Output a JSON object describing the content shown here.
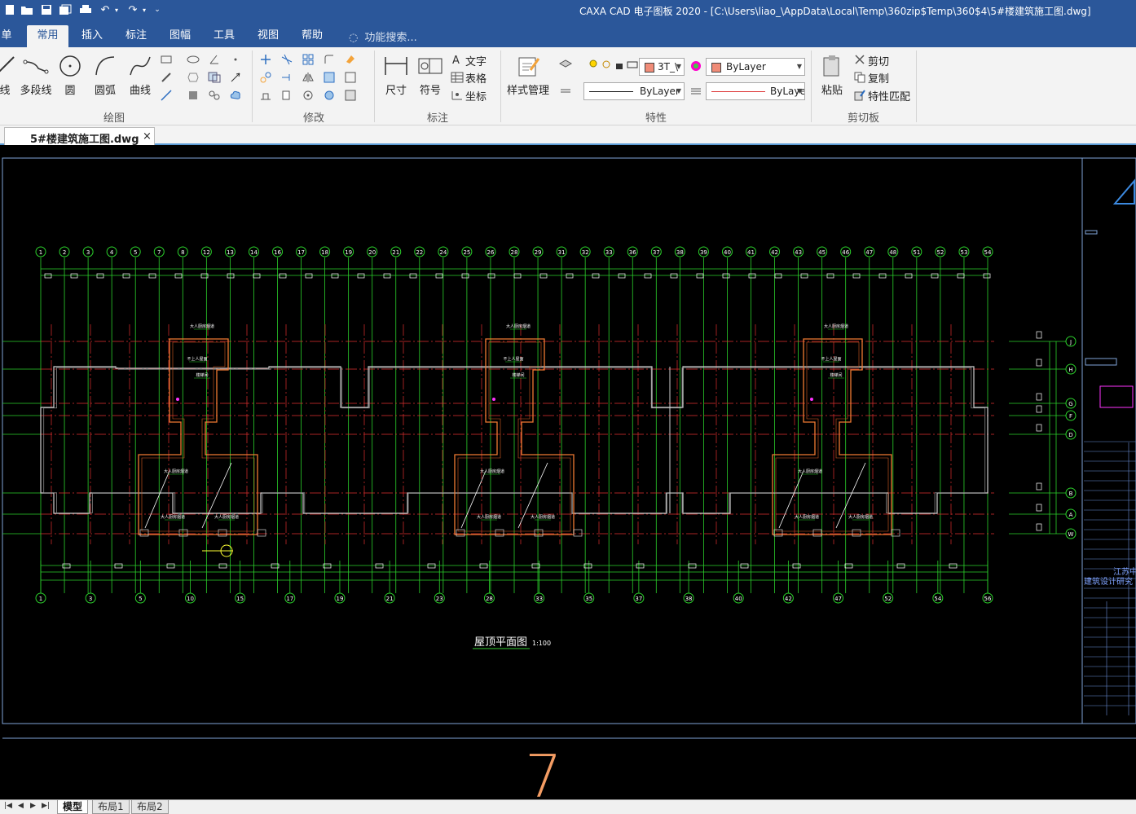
{
  "app": {
    "title": "CAXA CAD 电子图板 2020 - [C:\\Users\\liao_\\AppData\\Local\\Temp\\360zip$Temp\\360$4\\5#楼建筑施工图.dwg]"
  },
  "menu": {
    "tabs": [
      "单",
      "常用",
      "插入",
      "标注",
      "图幅",
      "工具",
      "视图",
      "帮助"
    ],
    "active": "常用",
    "search_placeholder": "功能搜索..."
  },
  "ribbon": {
    "groups": {
      "draw": "绘图",
      "modify": "修改",
      "annotate": "标注",
      "properties": "特性",
      "clipboard": "剪切板"
    },
    "draw_buttons": {
      "line": "线",
      "polyline": "多段线",
      "circle": "圆",
      "arc": "圆弧",
      "curve": "曲线"
    },
    "annotate_buttons": {
      "dimension": "尺寸",
      "symbol": "符号",
      "text": "文字",
      "table": "表格",
      "coordinate": "坐标"
    },
    "style_manager": "样式管理",
    "layer_value": "3T_\\",
    "color_value": "ByLayer",
    "linetype_value": "ByLayer",
    "lineweight_value": "ByLayе",
    "clipboard": {
      "paste": "粘贴",
      "cut": "剪切",
      "copy": "复制",
      "match": "特性匹配"
    }
  },
  "document": {
    "tab_label": "5#楼建筑施工图.dwg",
    "close_glyph": "×"
  },
  "drawing": {
    "plan_title": "屋顶平面图",
    "plan_scale": "1:100",
    "top_axis_labels": [
      "1",
      "2",
      "3",
      "4",
      "5",
      "7",
      "8",
      "12",
      "13",
      "14",
      "16",
      "17",
      "18",
      "19",
      "20",
      "21",
      "22",
      "24",
      "25",
      "26",
      "28",
      "29",
      "31",
      "32",
      "33",
      "36",
      "37",
      "38",
      "39",
      "40",
      "41",
      "42",
      "43",
      "45",
      "46",
      "47",
      "48",
      "51",
      "52",
      "53",
      "54"
    ],
    "bottom_axis_labels": [
      "1",
      "3",
      "5",
      "10",
      "15",
      "17",
      "19",
      "21",
      "23",
      "28",
      "33",
      "35",
      "37",
      "38",
      "40",
      "42",
      "47",
      "52",
      "54",
      "56"
    ],
    "right_axis_labels": [
      "J",
      "H",
      "G",
      "F",
      "D",
      "B",
      "A",
      "W"
    ],
    "room_labels": [
      "大人厨房烟道",
      "不上人屋面",
      "楼梯间",
      "大人厨房烟道",
      "大人厨房烟道",
      "大人厨房烟道"
    ],
    "title_block_text": [
      "江苏中",
      "建筑设计研究"
    ],
    "sheet_number": "7"
  },
  "layouts": {
    "tabs": [
      "模型",
      "布局1",
      "布局2"
    ],
    "active": "模型"
  }
}
